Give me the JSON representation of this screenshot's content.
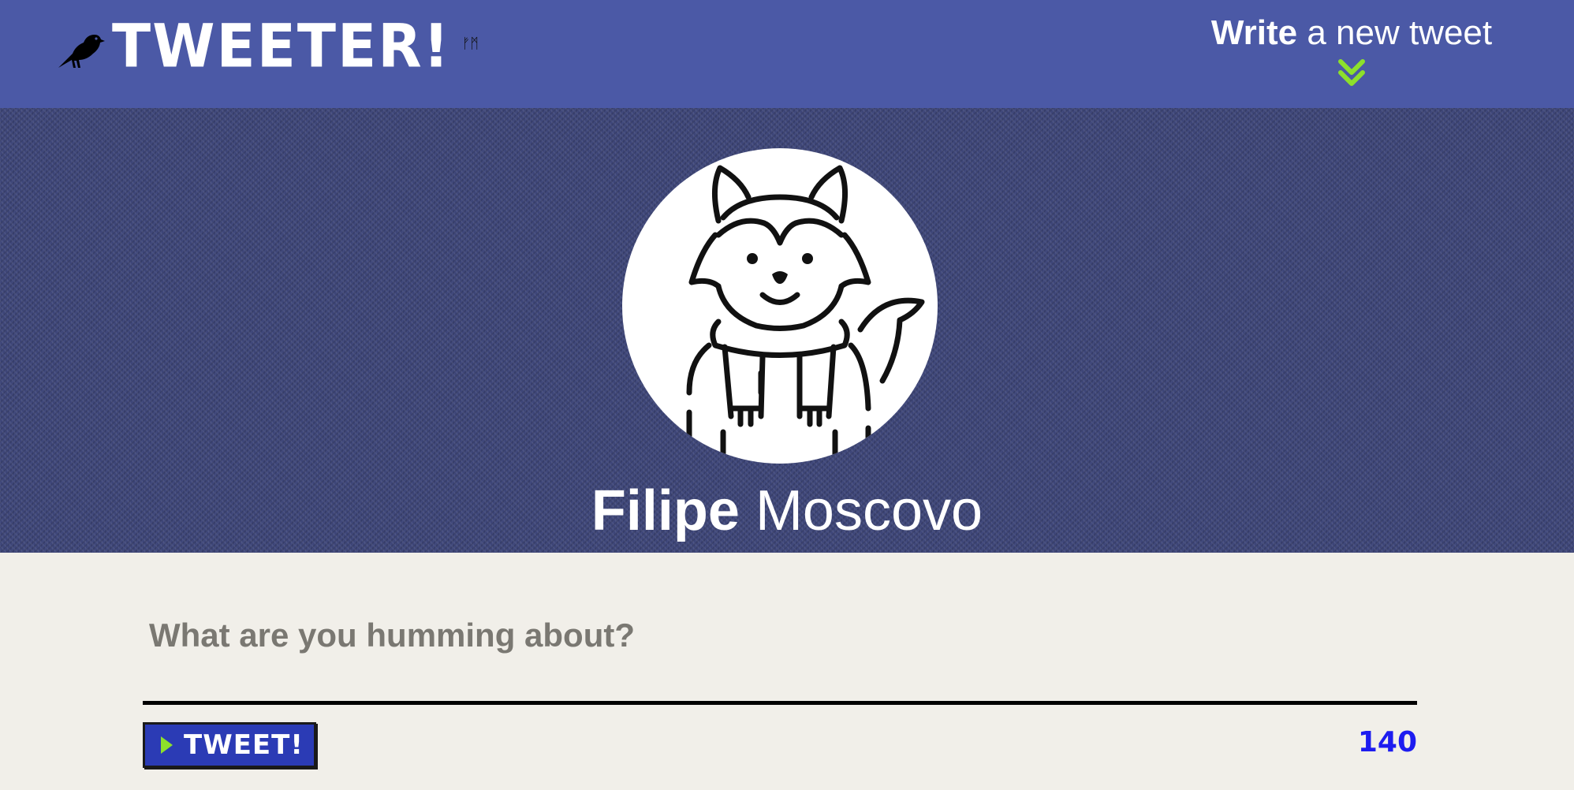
{
  "nav": {
    "brand_name": "TWEETER!",
    "brand_mark": "ᚠᛗ",
    "compose_toggle": {
      "bold": "Write",
      "rest": " a new tweet",
      "icon": "double-chevron-down-icon",
      "icon_color": "#8de02b"
    }
  },
  "profile": {
    "avatar_icon": "fox-avatar-icon",
    "first_name": "Filipe",
    "last_name": "Moscovo"
  },
  "composer": {
    "placeholder": "What are you humming about?",
    "value": "",
    "button_label": "TWEET!",
    "char_count": "140"
  },
  "colors": {
    "nav_bg": "#4b59a6",
    "banner_bg": "#3d4578",
    "page_bg": "#f1efe9",
    "button_bg": "#2b3bb5",
    "accent_green": "#8de02b",
    "counter_blue": "#1d1cf0"
  }
}
